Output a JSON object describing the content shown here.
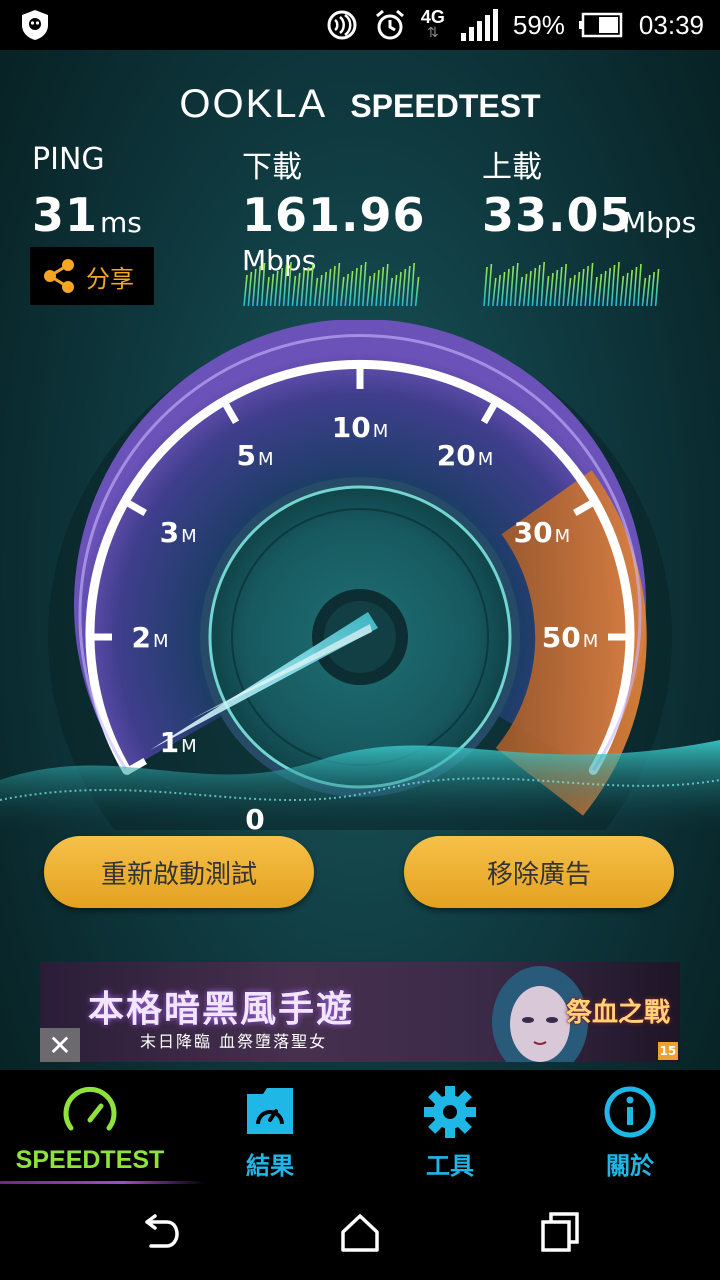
{
  "status_bar": {
    "battery": "59%",
    "time": "03:39",
    "network": "4G"
  },
  "brand": {
    "ookla": "OOKLA",
    "speedtest": "SPEEDTEST"
  },
  "ping": {
    "label": "PING",
    "value": "31",
    "unit": "ms"
  },
  "download": {
    "label": "下載",
    "value": "161.96",
    "unit": "Mbps"
  },
  "upload": {
    "label": "上載",
    "value": "33.05",
    "unit": "Mbps"
  },
  "share": {
    "label": "分享"
  },
  "gauge": {
    "ticks": [
      {
        "num": "0",
        "unit": ""
      },
      {
        "num": "1",
        "unit": "M"
      },
      {
        "num": "2",
        "unit": "M"
      },
      {
        "num": "3",
        "unit": "M"
      },
      {
        "num": "5",
        "unit": "M"
      },
      {
        "num": "10",
        "unit": "M"
      },
      {
        "num": "20",
        "unit": "M"
      },
      {
        "num": "30",
        "unit": "M"
      },
      {
        "num": "50",
        "unit": "M"
      }
    ]
  },
  "buttons": {
    "restart": "重新啟動測試",
    "remove_ads": "移除廣告"
  },
  "ad": {
    "title": "本格暗黑風手遊",
    "subtitle": "末日降臨 血祭墮落聖女",
    "game": "祭血之戰",
    "rating": "15"
  },
  "nav": {
    "items": [
      {
        "label": "SPEEDTEST"
      },
      {
        "label": "結果"
      },
      {
        "label": "工具"
      },
      {
        "label": "關於"
      }
    ]
  },
  "colors": {
    "accent_green": "#8fe13b",
    "accent_blue": "#1fb7e6",
    "button_gold": "#f0b43a",
    "share_orange": "#f5a623"
  }
}
